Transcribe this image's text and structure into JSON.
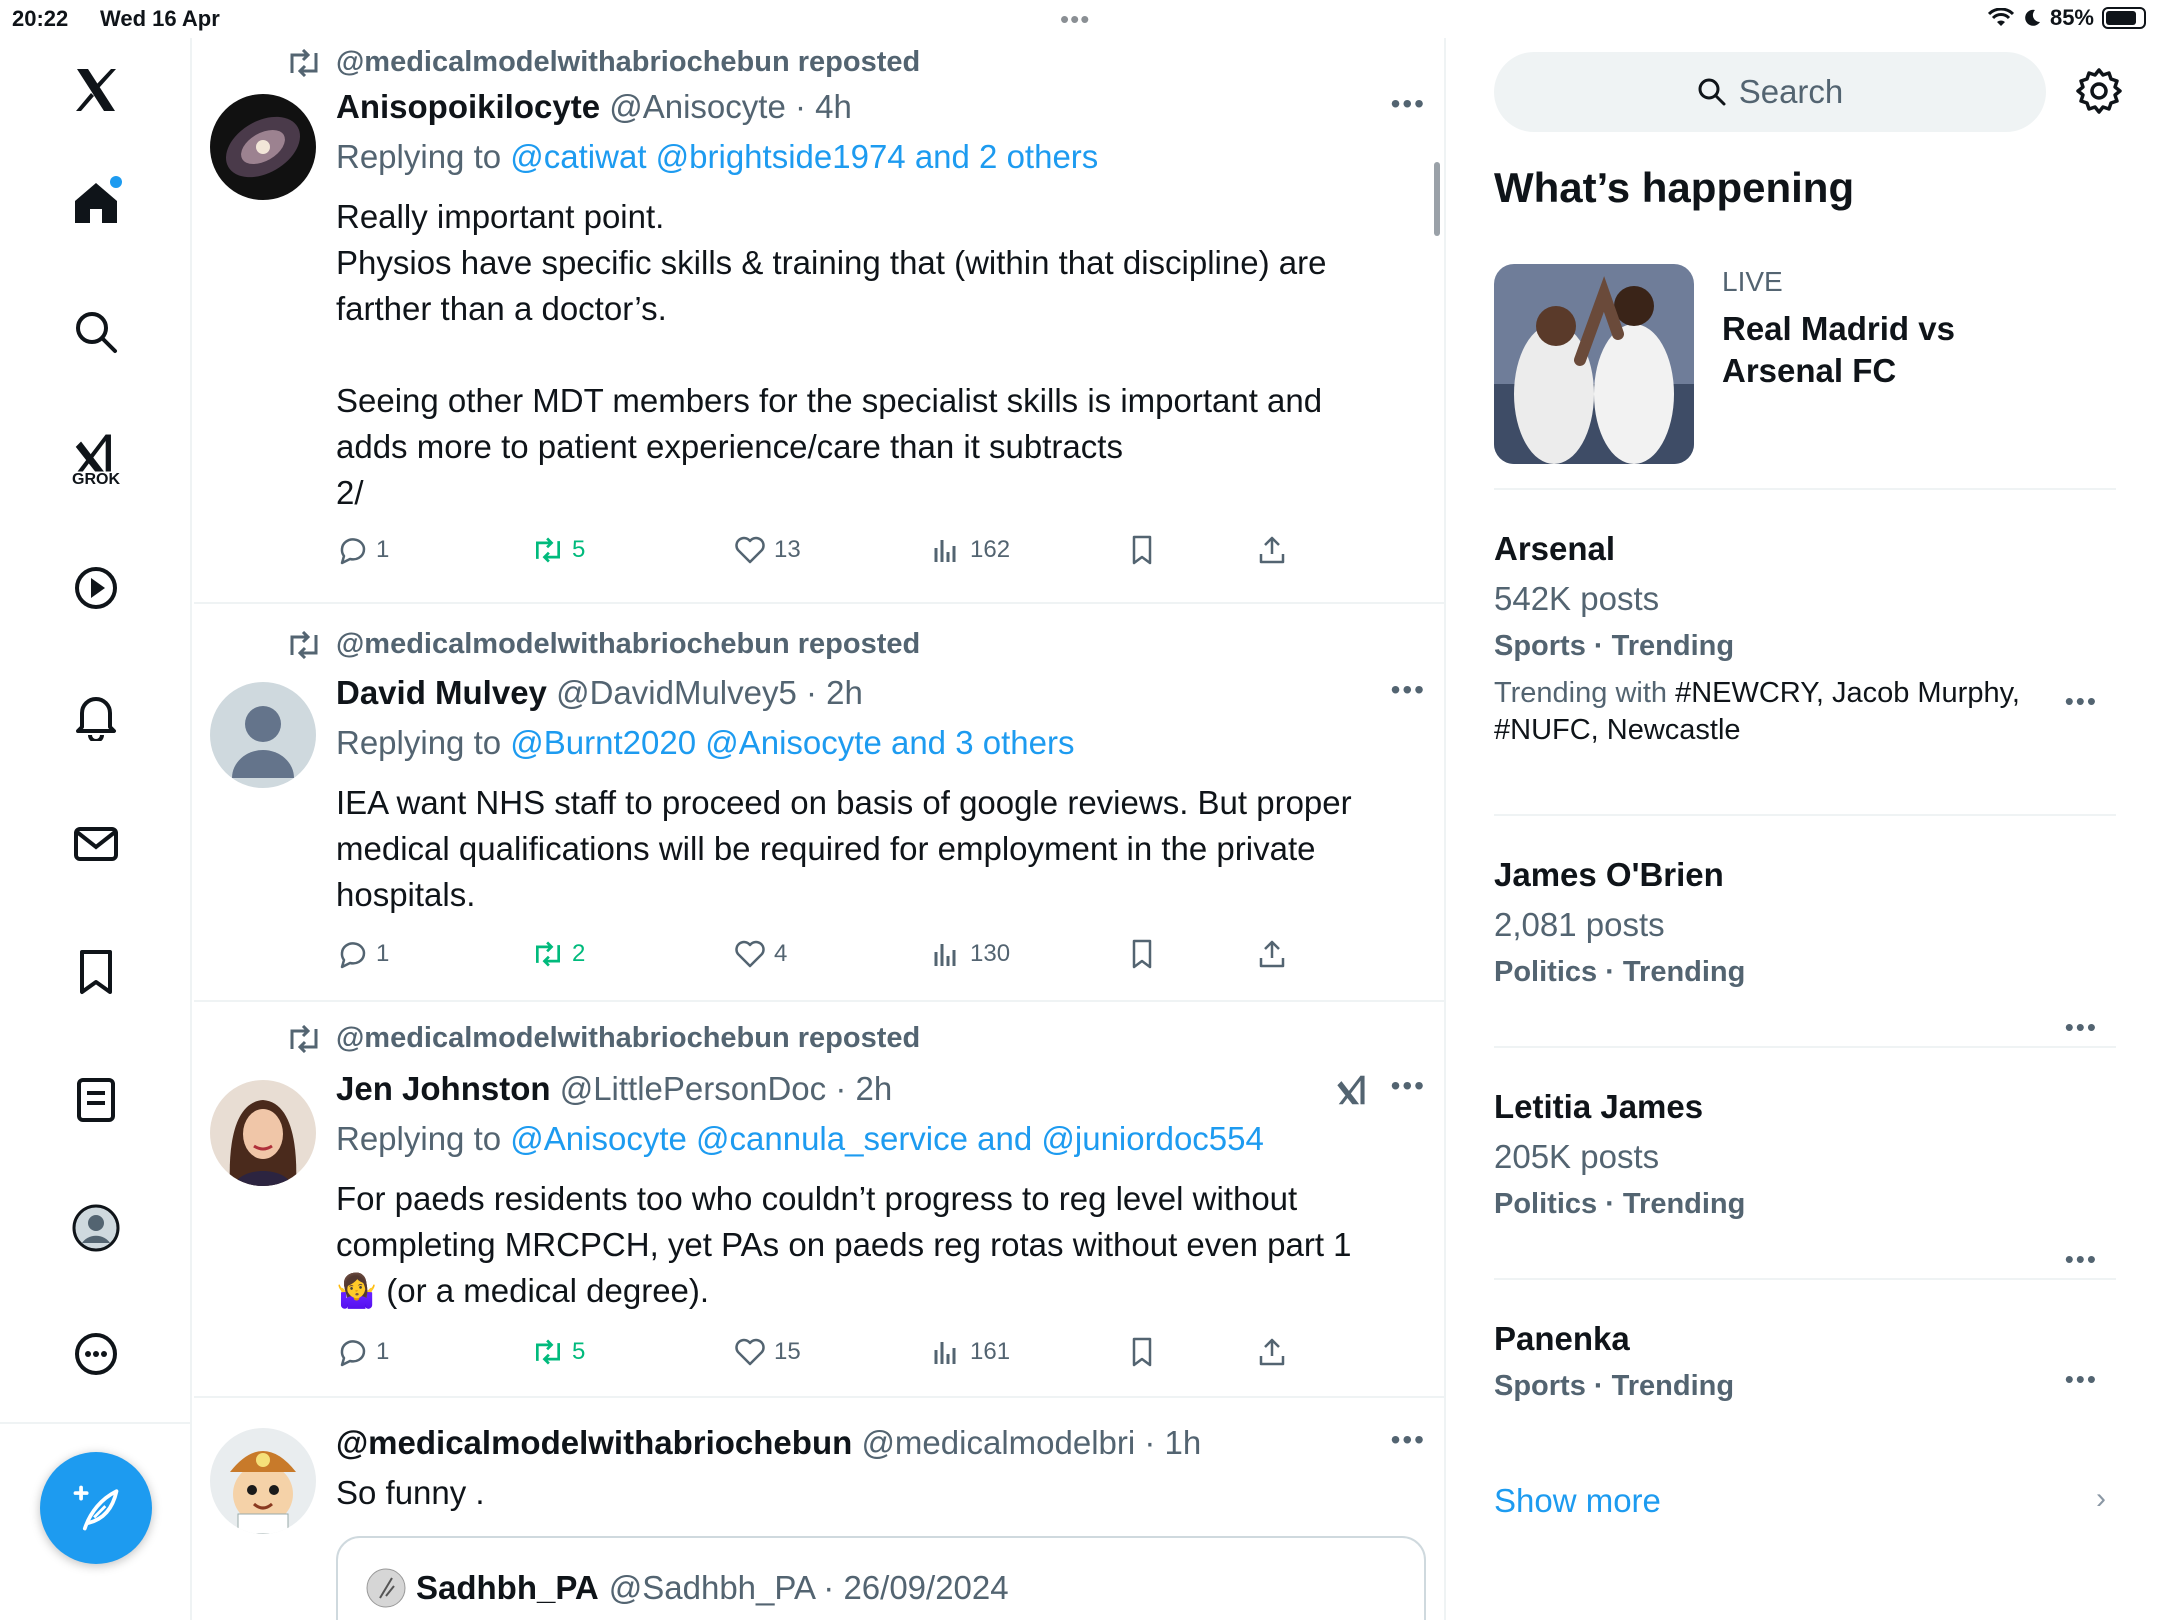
{
  "status_bar": {
    "time": "20:22",
    "date": "Wed 16 Apr",
    "battery": "85%",
    "battery_level": 0.85
  },
  "nav": {
    "grok_label": "GROK",
    "items": [
      "x-logo",
      "home",
      "search",
      "grok",
      "videos",
      "notifications",
      "messages",
      "bookmarks",
      "lists",
      "profile",
      "more"
    ]
  },
  "posts": [
    {
      "repost_label": "@medicalmodelwithabriochebun reposted",
      "name": "Anisopoikilocyte",
      "handle_time": "@Anisocyte · 4h",
      "replying_prefix": "Replying to",
      "replying_to": "@catiwat @brightside1974 and 2 others",
      "text": [
        "Really important point.",
        "Physios have specific skills & training that (within that discipline) are",
        "farther than a doctor’s.",
        "",
        "Seeing other MDT members for the specialist skills is important and",
        "adds more to patient experience/care than it subtracts",
        "2/"
      ],
      "replies": "1",
      "reposts": "5",
      "likes": "13",
      "views": "162"
    },
    {
      "repost_label": "@medicalmodelwithabriochebun reposted",
      "name": "David Mulvey",
      "handle_time": "@DavidMulvey5 · 2h",
      "replying_prefix": "Replying to",
      "replying_to": "@Burnt2020 @Anisocyte and 3 others",
      "text": [
        "IEA want NHS staff to proceed on basis of google reviews. But proper",
        "medical qualifications will be required for employment in the private",
        "hospitals."
      ],
      "replies": "1",
      "reposts": "2",
      "likes": "4",
      "views": "130"
    },
    {
      "repost_label": "@medicalmodelwithabriochebun reposted",
      "name": "Jen Johnston",
      "handle_time": "@LittlePersonDoc · 2h",
      "replying_prefix": "Replying to",
      "replying_to": "@Anisocyte @cannula_service and @juniordoc554",
      "text": [
        "For paeds residents too who couldn’t progress to reg level without",
        "completing MRCPCH, yet PAs on paeds reg rotas without even part 1",
        "🤷‍♀️ (or a medical degree)."
      ],
      "replies": "1",
      "reposts": "5",
      "likes": "15",
      "views": "161"
    },
    {
      "name": "@medicalmodelwithabriochebun",
      "handle_time": "@medicalmodelbri · 1h",
      "text": [
        "So funny ."
      ],
      "quote": {
        "name": "Sadhbh_PA",
        "handle_time": "@Sadhbh_PA · 26/09/2024"
      }
    }
  ],
  "sidebar": {
    "search_placeholder": "Search",
    "section_title": "What’s happening",
    "live": {
      "label": "LIVE",
      "title": "Real Madrid vs Arsenal FC"
    },
    "trends": [
      {
        "name": "Arsenal",
        "posts": "542K posts",
        "meta": "Sports · Trending",
        "with_prefix": "Trending with",
        "with_tags": "#NEWCRY, Jacob Murphy, #NUFC, Newcastle"
      },
      {
        "name": "James O'Brien",
        "posts": "2,081 posts",
        "meta": "Politics · Trending"
      },
      {
        "name": "Letitia James",
        "posts": "205K posts",
        "meta": "Politics · Trending"
      },
      {
        "name": "Panenka",
        "meta": "Sports · Trending"
      }
    ],
    "show_more": "Show more"
  },
  "colors": {
    "accent": "#1d9bf0",
    "repost_green": "#00ba7c",
    "secondary_text": "#536471",
    "divider": "#eff3f4"
  }
}
